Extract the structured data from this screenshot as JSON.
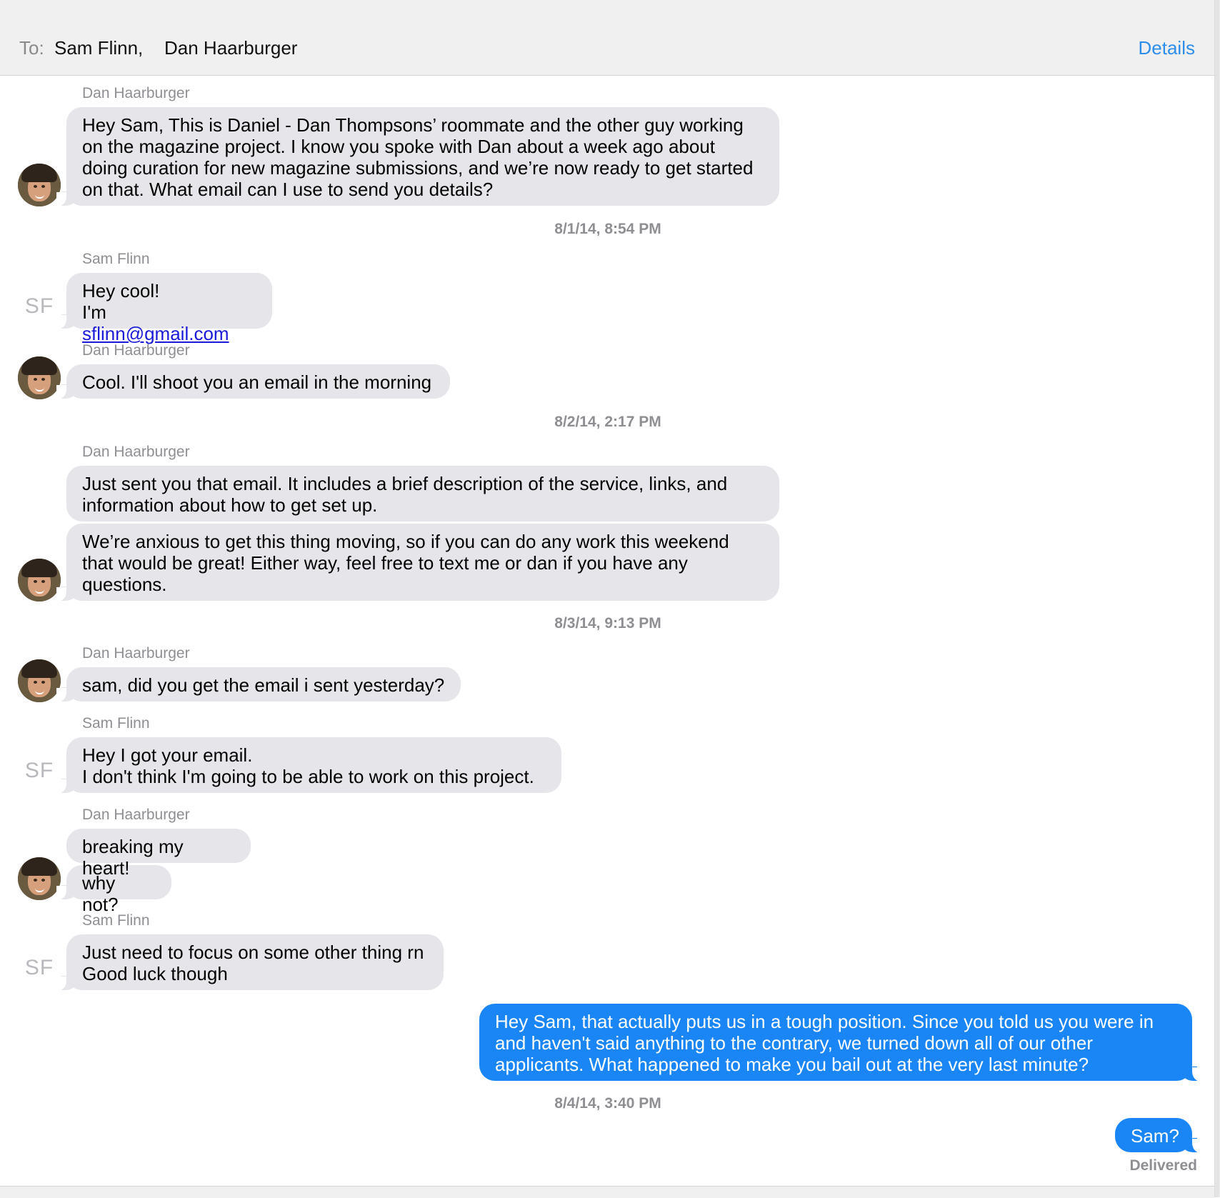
{
  "header": {
    "to_label": "To:",
    "recipients": [
      "Sam Flinn,",
      "Dan Haarburger"
    ],
    "details_label": "Details"
  },
  "avatar": {
    "dan_icon": "photo-avatar",
    "sam_initials": "SF"
  },
  "thread": {
    "s1": "Dan Haarburger",
    "m1": [
      "Hey Sam, This is Daniel - Dan Thompsons’ roommate and the other guy working",
      "on the magazine project. I know you spoke with Dan about a week ago about",
      "doing curation for new magazine submissions, and we’re now ready to get started",
      "on that. What email can I use to send you details?"
    ],
    "t1": "8/1/14, 8:54 PM",
    "s2": "Sam Flinn",
    "m2_line1": "Hey cool!",
    "m2_prefix": "I'm ",
    "m2_link": "sflinn@gmail.com",
    "s3": "Dan Haarburger",
    "m3": "Cool. I'll shoot you an email in the morning",
    "t2": "8/2/14, 2:17 PM",
    "s4": "Dan Haarburger",
    "m4": [
      "Just sent you that email. It includes a brief description of the service, links, and",
      "information about how to get set up."
    ],
    "m5": [
      "We’re anxious to get this thing moving, so if you can do any work this weekend",
      "that would be great! Either way, feel free to text me or dan if you have any",
      "questions."
    ],
    "t3": "8/3/14, 9:13 PM",
    "s5": "Dan Haarburger",
    "m6": "sam, did you get the email i sent yesterday?",
    "s6": "Sam Flinn",
    "m7": [
      "Hey I got your email.",
      "I don't think I'm going to be able to work on this project."
    ],
    "s7": "Dan Haarburger",
    "m8": "breaking my heart!",
    "m9": "why not?",
    "s8": "Sam Flinn",
    "m10": [
      "Just need to focus on some other thing rn",
      "Good luck though"
    ],
    "m11": [
      "Hey Sam, that actually puts us in a tough position. Since you told us you were in",
      "and haven't said anything to the contrary, we turned down all of our other",
      "applicants. What happened to make you bail out at the very last minute?"
    ],
    "t4": "8/4/14, 3:40 PM",
    "m12": "Sam?",
    "status": "Delivered"
  },
  "colors": {
    "incoming_bubble": "#e5e5ea",
    "outgoing_bubble": "#1a86f5",
    "accent": "#2d8ee9",
    "meta_text": "#8e8e93"
  }
}
